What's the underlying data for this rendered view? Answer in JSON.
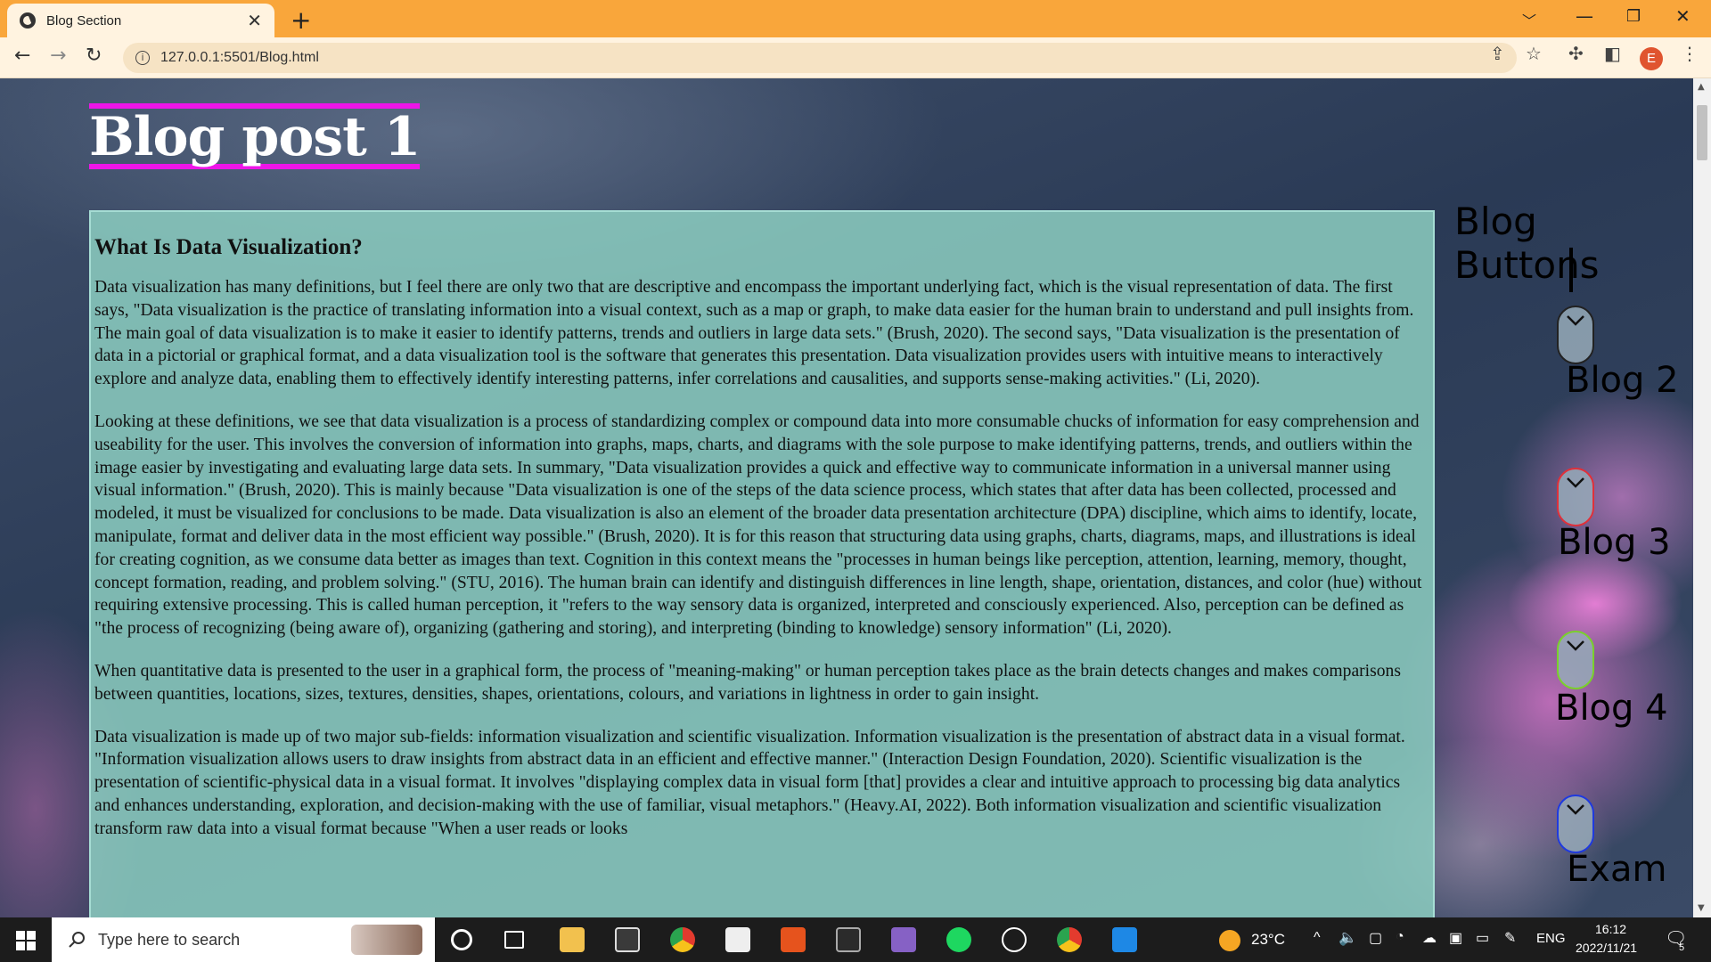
{
  "browser": {
    "tab_title": "Blog Section",
    "url": "127.0.0.1:5501/Blog.html",
    "profile_initial": "E"
  },
  "page": {
    "title": "Blog post 1",
    "heading": "What Is Data Visualization?",
    "paragraphs": [
      "Data visualization has many definitions, but I feel there are only two that are descriptive and encompass the important underlying fact, which is the visual representation of data. The first says, \"Data visualization is the practice of translating information into a visual context, such as a map or graph, to make data easier for the human brain to understand and pull insights from. The main goal of data visualization is to make it easier to identify patterns, trends and outliers in large data sets.\" (Brush, 2020). The second says, \"Data visualization is the presentation of data in a pictorial or graphical format, and a data visualization tool is the software that generates this presentation. Data visualization provides users with intuitive means to interactively explore and analyze data, enabling them to effectively identify interesting patterns, infer correlations and causalities, and supports sense-making activities.\" (Li, 2020).",
      "Looking at these definitions, we see that data visualization is a process of standardizing complex or compound data into more consumable chucks of information for easy comprehension and useability for the user. This involves the conversion of information into graphs, maps, charts, and diagrams with the sole purpose to make identifying patterns, trends, and outliers within the image easier by investigating and evaluating large data sets. In summary, \"Data visualization provides a quick and effective way to communicate information in a universal manner using visual information.\" (Brush, 2020). This is mainly because \"Data visualization is one of the steps of the data science process, which states that after data has been collected, processed and modeled, it must be visualized for conclusions to be made. Data visualization is also an element of the broader data presentation architecture (DPA) discipline, which aims to identify, locate, manipulate, format and deliver data in the most efficient way possible.\" (Brush, 2020). It is for this reason that structuring data using graphs, charts, diagrams, maps, and illustrations is ideal for creating cognition, as we consume data better as images than text. Cognition in this context means the \"processes in human beings like perception, attention, learning, memory, thought, concept formation, reading, and problem solving.\" (STU, 2016). The human brain can identify and distinguish differences in line length, shape, orientation, distances, and color (hue) without requiring extensive processing. This is called human perception, it \"refers to the way sensory data is organized, interpreted and consciously experienced. Also, perception can be defined as \"the process of recognizing (being aware of), organizing (gathering and storing), and interpreting (binding to knowledge) sensory information\" (Li, 2020).",
      "When quantitative data is presented to the user in a graphical form, the process of \"meaning-making\" or human perception takes place as the brain detects changes and makes comparisons between quantities, locations, sizes, textures, densities, shapes, orientations, colours, and variations in lightness in order to gain insight.",
      "Data visualization is made up of two major sub-fields: information visualization and scientific visualization. Information visualization is the presentation of abstract data in a visual format. \"Information visualization allows users to draw insights from abstract data in an efficient and effective manner.\" (Interaction Design Foundation, 2020). Scientific visualization is the presentation of scientific-physical data in a visual format. It involves \"displaying complex data in visual form [that] provides a clear and intuitive approach to processing big data analytics and enhances understanding, exploration, and decision-making with the use of familiar, visual metaphors.\" (Heavy.AI, 2022). Both information visualization and scientific visualization transform raw data into a visual format because \"When a user reads or looks"
    ]
  },
  "side_nav": {
    "title": "Blog Buttons",
    "buttons": [
      {
        "label": "Blog 2",
        "border_color": "#222222"
      },
      {
        "label": "Blog 3",
        "border_color": "#e0303a"
      },
      {
        "label": "Blog 4",
        "border_color": "#7ad12b"
      },
      {
        "label": "Exam",
        "border_color": "#1f3adf"
      }
    ]
  },
  "taskbar": {
    "search_placeholder": "Type here to search",
    "weather": "23°C",
    "language": "ENG",
    "time": "16:12",
    "date": "2022/11/21",
    "notification_count": "5"
  },
  "icons": {
    "back": "arrow-left-icon",
    "forward": "arrow-right-icon",
    "reload": "reload-icon",
    "chevron": "chevron-down-icon"
  }
}
